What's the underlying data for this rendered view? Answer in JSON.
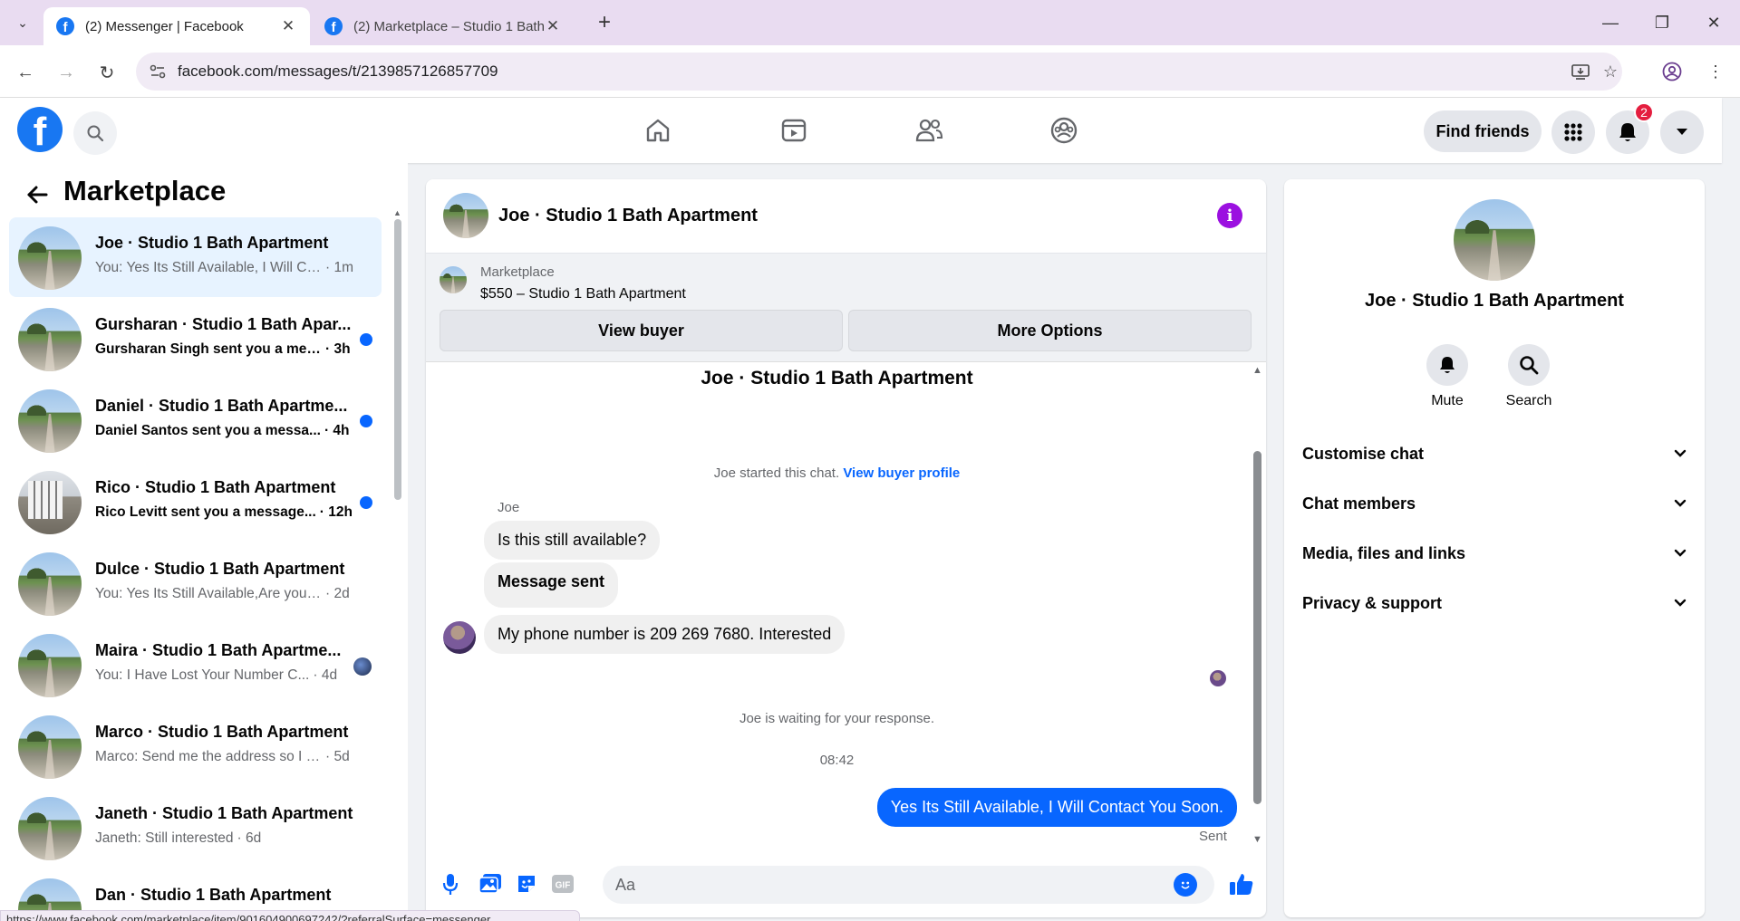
{
  "browser": {
    "tabs": [
      {
        "title": "(2) Messenger | Facebook",
        "active": true
      },
      {
        "title": "(2) Marketplace – Studio 1 Bath",
        "active": false
      }
    ],
    "url": "facebook.com/messages/t/2139857126857709",
    "status_url": "https://www.facebook.com/marketplace/item/901604900697242/?referralSurface=messenger..."
  },
  "header": {
    "find_friends": "Find friends",
    "notification_count": "2"
  },
  "sidebar": {
    "title": "Marketplace",
    "conversations": [
      {
        "name": "Joe · Studio 1 Bath Apartment",
        "preview": "You: Yes Its Still Available, I Will Co...",
        "time": "· 1m",
        "unread": false,
        "active": true,
        "avatar": "landscape"
      },
      {
        "name": "Gursharan · Studio 1 Bath Apar...",
        "preview": "Gursharan Singh sent you a mes...",
        "time": "· 3h",
        "unread": true,
        "active": false,
        "avatar": "landscape"
      },
      {
        "name": "Daniel · Studio 1 Bath Apartme...",
        "preview": "Daniel Santos sent you a messa...",
        "time": "· 4h",
        "unread": true,
        "active": false,
        "avatar": "landscape"
      },
      {
        "name": "Rico · Studio 1 Bath Apartment",
        "preview": "Rico Levitt sent you a message...",
        "time": "· 12h",
        "unread": true,
        "active": false,
        "avatar": "building"
      },
      {
        "name": "Dulce · Studio 1 Bath Apartment",
        "preview": "You: Yes Its Still Available,Are you in...",
        "time": "· 2d",
        "unread": false,
        "active": false,
        "avatar": "landscape"
      },
      {
        "name": "Maira · Studio 1 Bath Apartme...",
        "preview": "You: I Have Lost Your Number C...",
        "time": "· 4d",
        "unread": false,
        "active": false,
        "seen": true,
        "avatar": "landscape"
      },
      {
        "name": "Marco · Studio 1 Bath Apartment",
        "preview": "Marco: Send me the address so I c...",
        "time": "· 5d",
        "unread": false,
        "active": false,
        "avatar": "landscape"
      },
      {
        "name": "Janeth · Studio 1 Bath Apartment",
        "preview": "Janeth: Still interested",
        "time": "· 6d",
        "unread": false,
        "active": false,
        "avatar": "landscape"
      },
      {
        "name": "Dan · Studio 1 Bath Apartment",
        "preview": "",
        "time": "",
        "unread": false,
        "active": false,
        "avatar": "landscape"
      }
    ]
  },
  "chat": {
    "title": "Joe · Studio 1 Bath Apartment",
    "marketplace_label": "Marketplace",
    "listing": "$550 – Studio 1 Bath Apartment",
    "view_buyer": "View buyer",
    "more_options": "More Options",
    "top_name": "Joe · Studio 1 Bath Apartment",
    "started_text": "Joe started this chat.",
    "view_buyer_profile": "View buyer profile",
    "sender": "Joe",
    "messages": [
      {
        "text": "Is this still available?",
        "dir": "in"
      },
      {
        "text": "Message sent",
        "dir": "in"
      },
      {
        "text": "My phone number is 209 269 7680. Interested",
        "dir": "in"
      },
      {
        "text": "Yes Its Still Available, I Will Contact You Soon.",
        "dir": "out"
      }
    ],
    "waiting": "Joe is waiting for your response.",
    "time": "08:42",
    "sent": "Sent",
    "composer_placeholder": "Aa"
  },
  "right_panel": {
    "name": "Joe · Studio 1 Bath Apartment",
    "mute": "Mute",
    "search": "Search",
    "sections": [
      "Customise chat",
      "Chat members",
      "Media, files and links",
      "Privacy & support"
    ]
  },
  "colors": {
    "accent": "#0866ff",
    "brand": "#1877f2",
    "info": "#9b10e0",
    "badge": "#e41e3f"
  }
}
